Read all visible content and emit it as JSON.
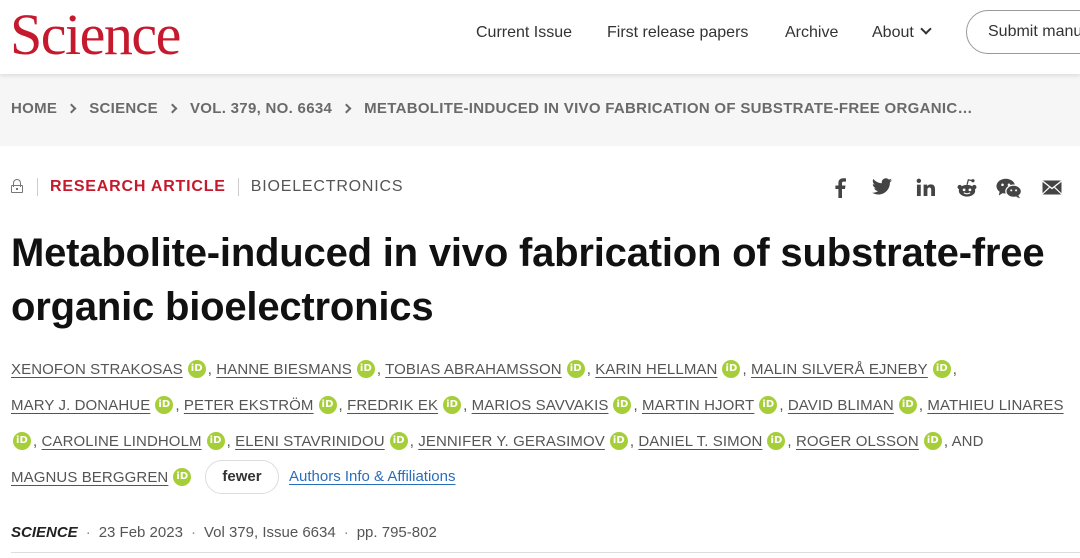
{
  "header": {
    "logo": "Science",
    "nav": {
      "current_issue": "Current Issue",
      "first_release": "First release papers",
      "archive": "Archive",
      "about": "About"
    },
    "submit_label": "Submit manuscript"
  },
  "breadcrumb": {
    "home": "HOME",
    "science": "SCIENCE",
    "volume": "VOL. 379, NO. 6634",
    "article": "METABOLITE-INDUCED IN VIVO FABRICATION OF SUBSTRATE-FREE ORGANIC…"
  },
  "article": {
    "type": "RESEARCH ARTICLE",
    "subject": "BIOELECTRONICS",
    "title_line1": "Metabolite-induced in vivo fabrication of substrate-free",
    "title_line2": "organic bioelectronics",
    "authors": [
      "XENOFON STRAKOSAS",
      "HANNE BIESMANS",
      "TOBIAS ABRAHAMSSON",
      "KARIN HELLMAN",
      "MALIN SILVERÅ EJNEBY",
      "MARY J. DONAHUE",
      "PETER EKSTRÖM",
      "FREDRIK EK",
      "MARIOS SAVVAKIS",
      "MARTIN HJORT",
      "DAVID BLIMAN",
      "MATHIEU LINARES",
      "CAROLINE LINDHOLM",
      "ELENI STAVRINIDOU",
      "JENNIFER Y. GERASIMOV",
      "DANIEL T. SIMON",
      "ROGER OLSSON",
      "MAGNUS BERGGREN"
    ],
    "and_label": "AND",
    "orcid_label": "iD",
    "fewer_label": "fewer",
    "affiliations_label": "Authors Info & Affiliations",
    "citation": {
      "journal": "SCIENCE",
      "date": "23 Feb 2023",
      "volume_issue": "Vol 379, Issue 6634",
      "pages": "pp. 795-802"
    }
  },
  "share_icons": [
    "facebook-icon",
    "twitter-icon",
    "linkedin-icon",
    "reddit-icon",
    "wechat-icon",
    "email-icon"
  ],
  "colors": {
    "brand_red": "#c5192d",
    "orcid_green": "#a6ce39",
    "link_blue": "#2a6ebb",
    "breadcrumb_bg": "#f6f6f6"
  }
}
